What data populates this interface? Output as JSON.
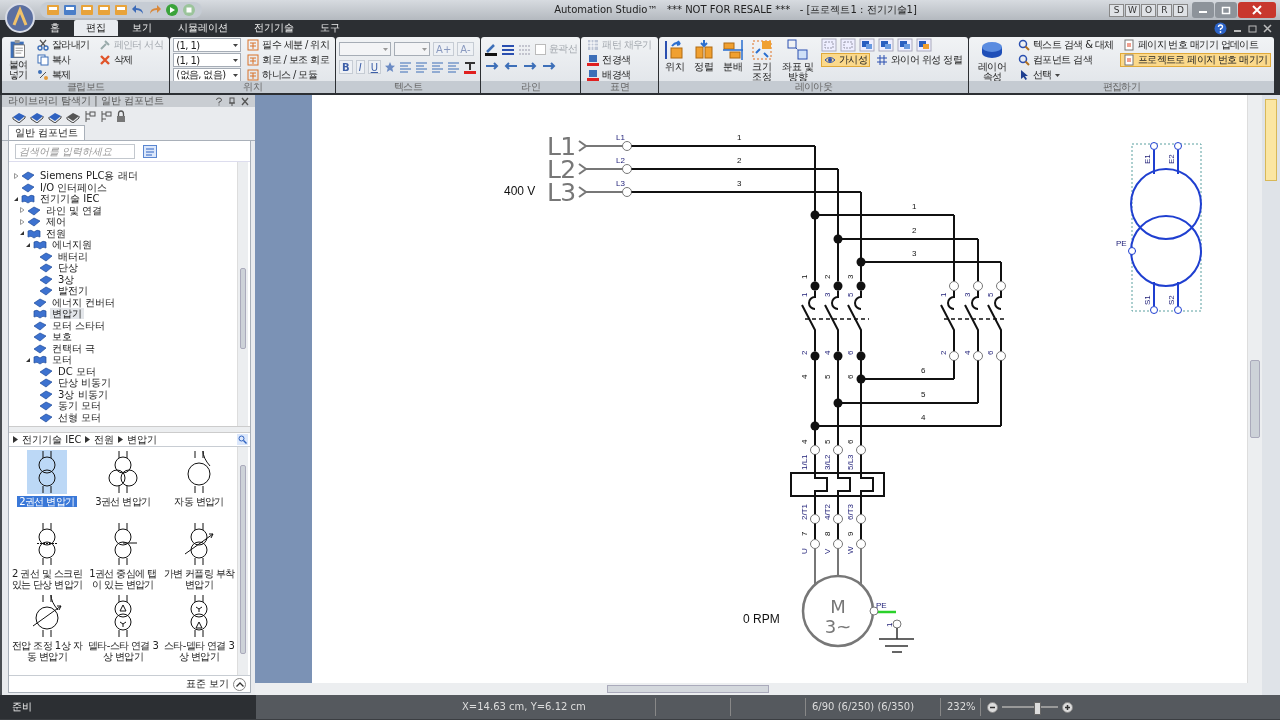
{
  "window": {
    "title": "Automation Studio™   *** NOT FOR RESALE ***   - [프로젝트1 : 전기기술1]",
    "letter_buttons": [
      "S",
      "W",
      "O",
      "R",
      "D"
    ]
  },
  "tabs": [
    {
      "label": "홈",
      "selected": false
    },
    {
      "label": "편집",
      "selected": true
    },
    {
      "label": "보기",
      "selected": false
    },
    {
      "label": "시뮬레이션",
      "selected": false
    },
    {
      "label": "전기기술",
      "selected": false
    },
    {
      "label": "도구",
      "selected": false
    }
  ],
  "ribbon": {
    "clipboard": {
      "title": "클립보드",
      "paste": "붙여넣기",
      "cut": "잘라내기",
      "copy": "복사",
      "duplicate": "복제",
      "format_painter": {
        "label": "페인터 서식",
        "disabled": true
      },
      "delete": "삭제"
    },
    "position": {
      "title": "위치",
      "combos": [
        "(1, 1)",
        "(1, 1)",
        "(없음, 없음)"
      ],
      "links": [
        "필수 세분 / 위치",
        "회로 / 보조 회로",
        "하니스 / 모듈"
      ]
    },
    "text": {
      "title": "텍스트",
      "grow": "A+",
      "shrink": "A-",
      "bold": "B",
      "italic": "I",
      "underline": "U"
    },
    "line": {
      "title": "라인",
      "outline": {
        "label": "윤곽선",
        "checked": false,
        "disabled": true
      }
    },
    "surface": {
      "title": "표면",
      "pattern_fill": {
        "label": "패턴 채우기",
        "disabled": true
      },
      "foreground": "전경색",
      "background": "배경색"
    },
    "layout": {
      "title": "레이아웃",
      "position": "위치",
      "align": "정렬",
      "distribute": "분배",
      "resize": "크기 조정",
      "coords": "좌표 및 방향",
      "visibility": {
        "label": "가시성",
        "selected": true
      },
      "wire_align": "와이어 위성 정렬"
    },
    "edit": {
      "title": "편집하기",
      "layer": "레이어 속성",
      "find_replace": "텍스트 검색 & 대체",
      "find_component": "컴포넌트 검색",
      "select": "선택",
      "page_update": "페이지 번호 매기기 업데이트",
      "page_project": {
        "label": "프로젝트로 페이지 번호 매기기",
        "selected": true
      }
    }
  },
  "library": {
    "title": "라이브러리 탐색기 | 일반 컴포넌트",
    "tab": {
      "label": "일반 컴포넌트",
      "selected": true
    },
    "search": {
      "placeholder": "검색어를 입력하세요"
    },
    "tree": [
      {
        "label": "Siemens PLC용 래더",
        "expanded": false,
        "selected": false
      },
      {
        "label": "I/O 인터페이스",
        "selected": false
      },
      {
        "label": "전기기술 IEC",
        "expanded": true,
        "selected": false,
        "children": [
          {
            "label": "라인 및 연결",
            "expanded": false,
            "selected": false
          },
          {
            "label": "제어",
            "expanded": false,
            "selected": false
          },
          {
            "label": "전원",
            "expanded": true,
            "selected": false,
            "children": [
              {
                "label": "에너지원",
                "expanded": true,
                "selected": false,
                "children": [
                  {
                    "label": "배터리",
                    "selected": false
                  },
                  {
                    "label": "단상",
                    "selected": false
                  },
                  {
                    "label": "3상",
                    "selected": false
                  },
                  {
                    "label": "발전기",
                    "selected": false
                  }
                ]
              },
              {
                "label": "에너지 컨버터",
                "selected": false
              },
              {
                "label": "변압기",
                "selected": true
              },
              {
                "label": "모터 스타터",
                "selected": false
              },
              {
                "label": "보호",
                "selected": false
              },
              {
                "label": "컨택터 극",
                "selected": false
              },
              {
                "label": "모터",
                "expanded": true,
                "selected": false,
                "children": [
                  {
                    "label": "DC 모터",
                    "selected": false
                  },
                  {
                    "label": "단상 비동기",
                    "selected": false
                  },
                  {
                    "label": "3상 비동기",
                    "selected": false
                  },
                  {
                    "label": "동기 모터",
                    "selected": false
                  },
                  {
                    "label": "선형 모터",
                    "selected": false
                  }
                ]
              }
            ]
          }
        ]
      }
    ],
    "breadcrumb": [
      "전기기술 IEC",
      "전원",
      "변압기"
    ],
    "gallery": [
      {
        "label": "2권선 변압기",
        "selected": true
      },
      {
        "label": "3권선 변압기",
        "selected": false
      },
      {
        "label": "자동 변압기",
        "selected": false
      },
      {
        "label": "2 권선 및 스크린 있는 단상 변압기",
        "selected": false
      },
      {
        "label": "1권선 중심에 탭이 있는 변압기",
        "selected": false
      },
      {
        "label": "가변 커플링 부착 변압기",
        "selected": false
      },
      {
        "label": "전압 조정 1상 자동 변압기",
        "selected": false
      },
      {
        "label": "델타-스타 연결 3상 변압기",
        "selected": false
      },
      {
        "label": "스타-델타 연결 3상 변압기",
        "selected": false
      }
    ],
    "footer": "표준 보기"
  },
  "schematic": {
    "voltage": "400 V",
    "lines": [
      {
        "name": "L1",
        "terminal": "L1",
        "wire": "1"
      },
      {
        "name": "L2",
        "terminal": "L2",
        "wire": "2"
      },
      {
        "name": "L3",
        "terminal": "L3",
        "wire": "3"
      }
    ],
    "branch_wires": [
      "1",
      "2",
      "3"
    ],
    "forward_contactor": {
      "wires": [
        "1",
        "2",
        "3"
      ],
      "poles_in": [
        "1",
        "3",
        "5"
      ],
      "poles_out": [
        "2",
        "4",
        "6"
      ],
      "out_wires": [
        "4",
        "5",
        "6"
      ]
    },
    "reverse_contactor": {
      "poles_in": [
        "1",
        "3",
        "5"
      ],
      "poles_out": [
        "2",
        "4",
        "6"
      ]
    },
    "cross_wires": [
      "6",
      "5",
      "4"
    ],
    "overload_relay": {
      "wires": [
        "4",
        "5",
        "6"
      ],
      "inputs": [
        "1/L1",
        "3/L2",
        "5/L3"
      ],
      "outputs": [
        "2/T1",
        "4/T2",
        "6/T3"
      ]
    },
    "motor": {
      "wires": [
        "7",
        "8",
        "9"
      ],
      "terminals": [
        "U",
        "V",
        "W"
      ],
      "symbol": "M",
      "phases": "3~",
      "pe": "PE",
      "ground_terminal": "1",
      "speed": "0 RPM"
    },
    "transformer": {
      "primary": [
        "E1",
        "E2"
      ],
      "secondary": [
        "S1",
        "S2"
      ],
      "pe": "PE",
      "selected": true
    }
  },
  "status": {
    "text": "준비",
    "coords": "X=14.63 cm, Y=6.12 cm",
    "pages": "6/90 (6/250) (6/350)",
    "zoom": "232%",
    "zoom_slider": {
      "level": 0.62
    }
  }
}
